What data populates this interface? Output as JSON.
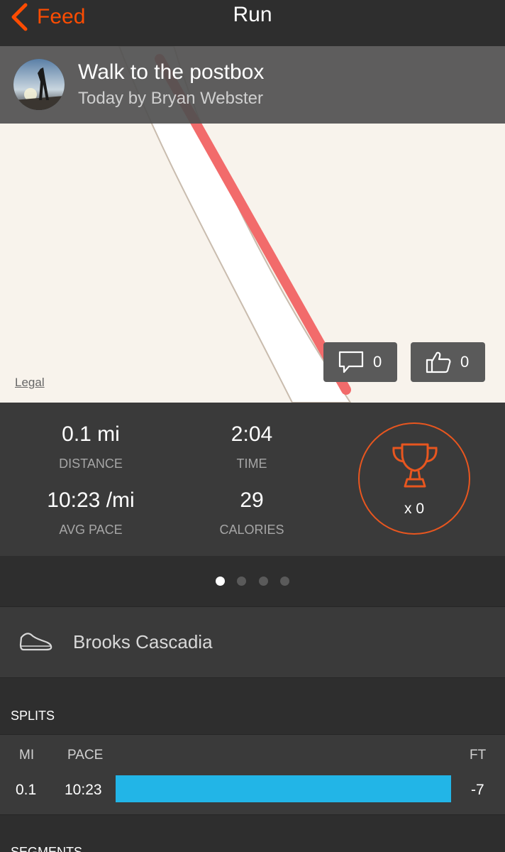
{
  "nav": {
    "back_label": "Feed",
    "title": "Run"
  },
  "activity": {
    "title": "Walk to the postbox",
    "subtitle": "Today by Bryan Webster"
  },
  "map": {
    "legal_label": "Legal",
    "comments_count": "0",
    "kudos_count": "0"
  },
  "stats": {
    "distance": {
      "value": "0.1 mi",
      "label": "DISTANCE"
    },
    "time": {
      "value": "2:04",
      "label": "TIME"
    },
    "avg_pace": {
      "value": "10:23 /mi",
      "label": "AVG PACE"
    },
    "calories": {
      "value": "29",
      "label": "CALORIES"
    },
    "achievements": "x 0"
  },
  "pager": {
    "pages": 4,
    "active": 0
  },
  "gear": {
    "name": "Brooks Cascadia"
  },
  "splits": {
    "title": "SPLITS",
    "headers": {
      "mi": "MI",
      "pace": "PACE",
      "ft": "FT"
    },
    "rows": [
      {
        "mi": "0.1",
        "pace": "10:23",
        "ft": "-7"
      }
    ]
  },
  "segments": {
    "title": "SEGMENTS"
  },
  "colors": {
    "accent": "#fc4c02",
    "route": "#f26b6b",
    "split_bar": "#22b5e7"
  }
}
